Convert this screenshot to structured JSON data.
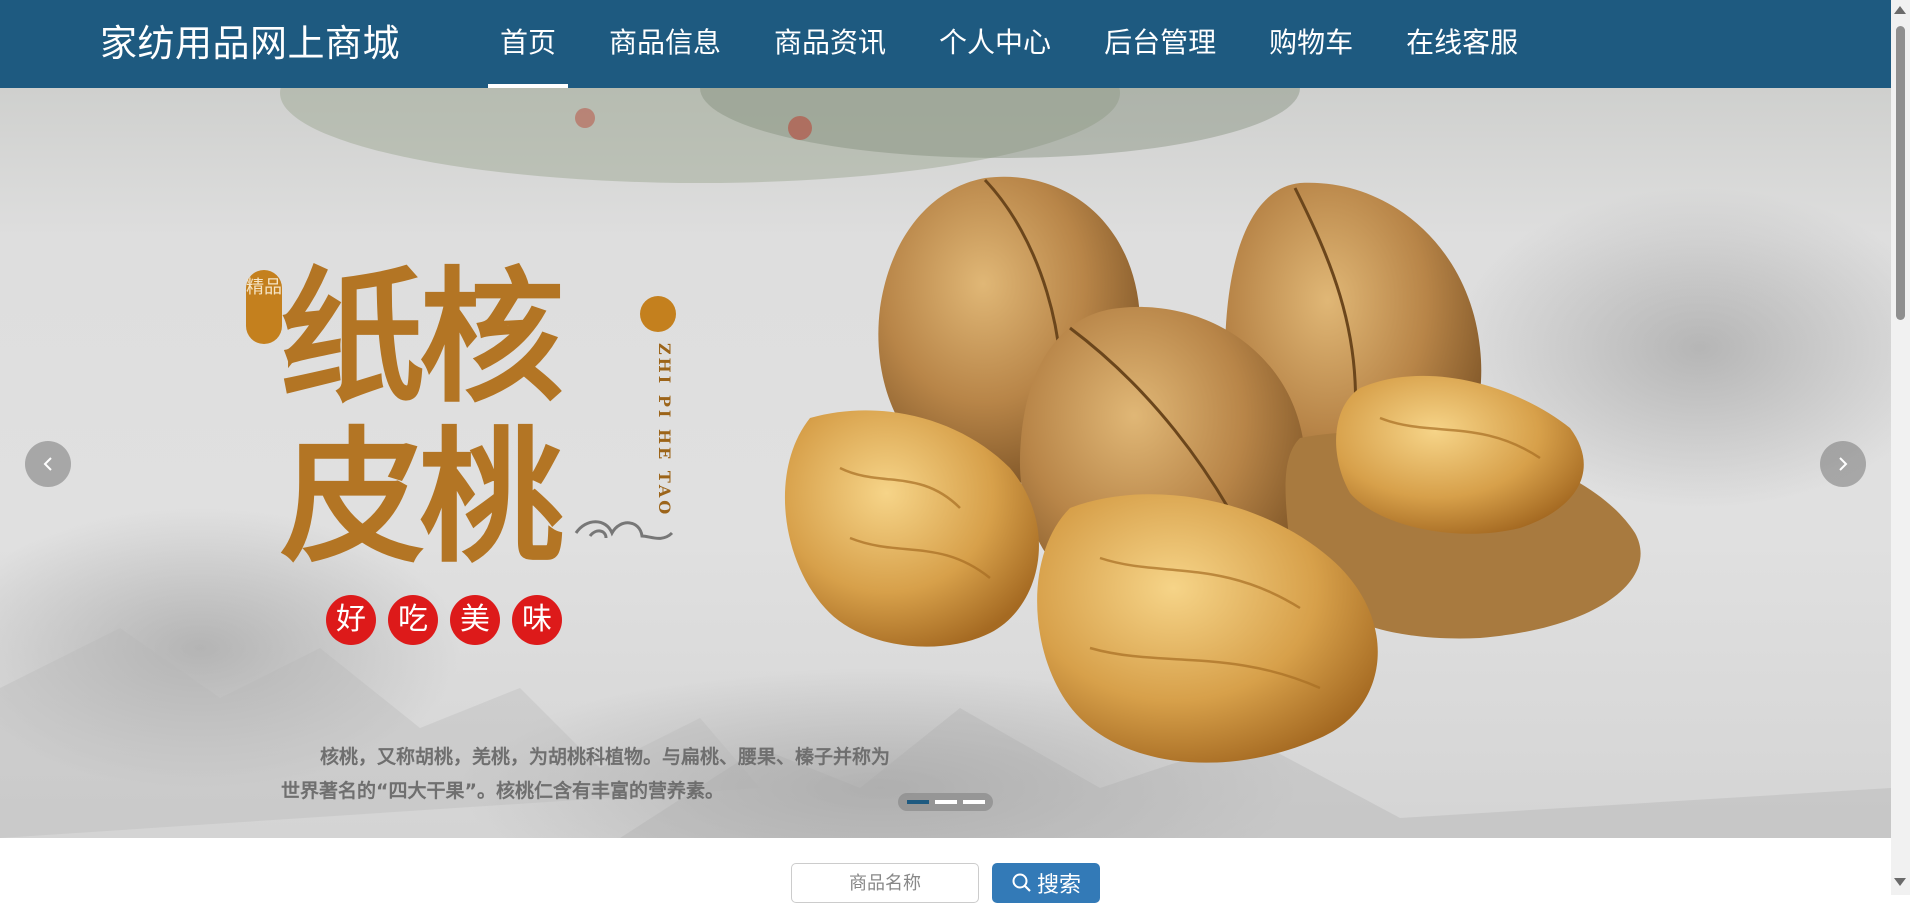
{
  "brand": "家纺用品网上商城",
  "nav": [
    {
      "label": "首页",
      "active": true
    },
    {
      "label": "商品信息"
    },
    {
      "label": "商品资讯"
    },
    {
      "label": "个人中心"
    },
    {
      "label": "后台管理"
    },
    {
      "label": "购物车"
    },
    {
      "label": "在线客服"
    }
  ],
  "banner": {
    "title_line1": "纸核",
    "title_line2": "皮桃",
    "seal_text": "精品",
    "pinyin": "ZHI PI HE TAO",
    "badges": [
      "好",
      "吃",
      "美",
      "味"
    ],
    "description": "核桃，又称胡桃，羌桃，为胡桃科植物。与扁桃、腰果、榛子并称为世界著名的“四大干果”。核桃仁含有丰富的营养素。",
    "slides": 3,
    "active_slide": 0,
    "icons": {
      "prev": "chevron-left-icon",
      "next": "chevron-right-icon"
    }
  },
  "search": {
    "placeholder": "商品名称",
    "button_label": "搜索",
    "button_icon": "search-icon"
  },
  "colors": {
    "header_bg": "#1e5a80",
    "button_bg": "#337ab7",
    "badge_red": "#dd1a1a",
    "title_brown": "#b37524"
  }
}
